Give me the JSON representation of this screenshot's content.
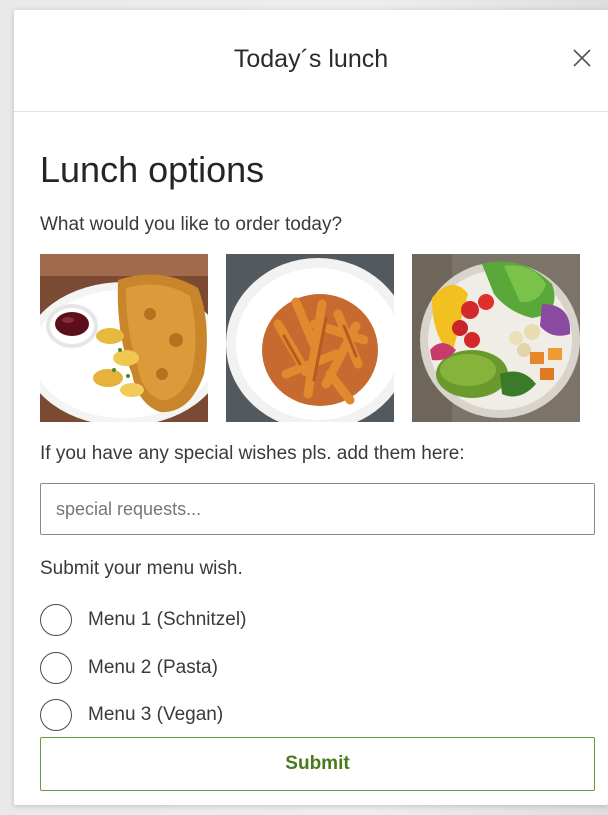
{
  "dialog": {
    "title": "Today´s lunch",
    "close_icon": "close-icon"
  },
  "content": {
    "heading": "Lunch options",
    "question": "What would you like to order today?",
    "images": [
      {
        "icon": "schnitzel-photo"
      },
      {
        "icon": "pasta-photo"
      },
      {
        "icon": "vegan-bowl-photo"
      }
    ],
    "wishes_label": "If you have any special wishes pls. add them here:",
    "request_input": {
      "placeholder": "special requests...",
      "value": ""
    },
    "submit_prompt": "Submit your menu wish.",
    "menu_options": [
      {
        "label": "Menu 1 (Schnitzel)",
        "selected": false
      },
      {
        "label": "Menu 2 (Pasta)",
        "selected": false
      },
      {
        "label": "Menu 3 (Vegan)",
        "selected": false
      }
    ],
    "submit_label": "Submit"
  },
  "colors": {
    "accent": "#6a9a3a",
    "accent_text": "#4a7a1e",
    "text": "#3a3a3a"
  }
}
